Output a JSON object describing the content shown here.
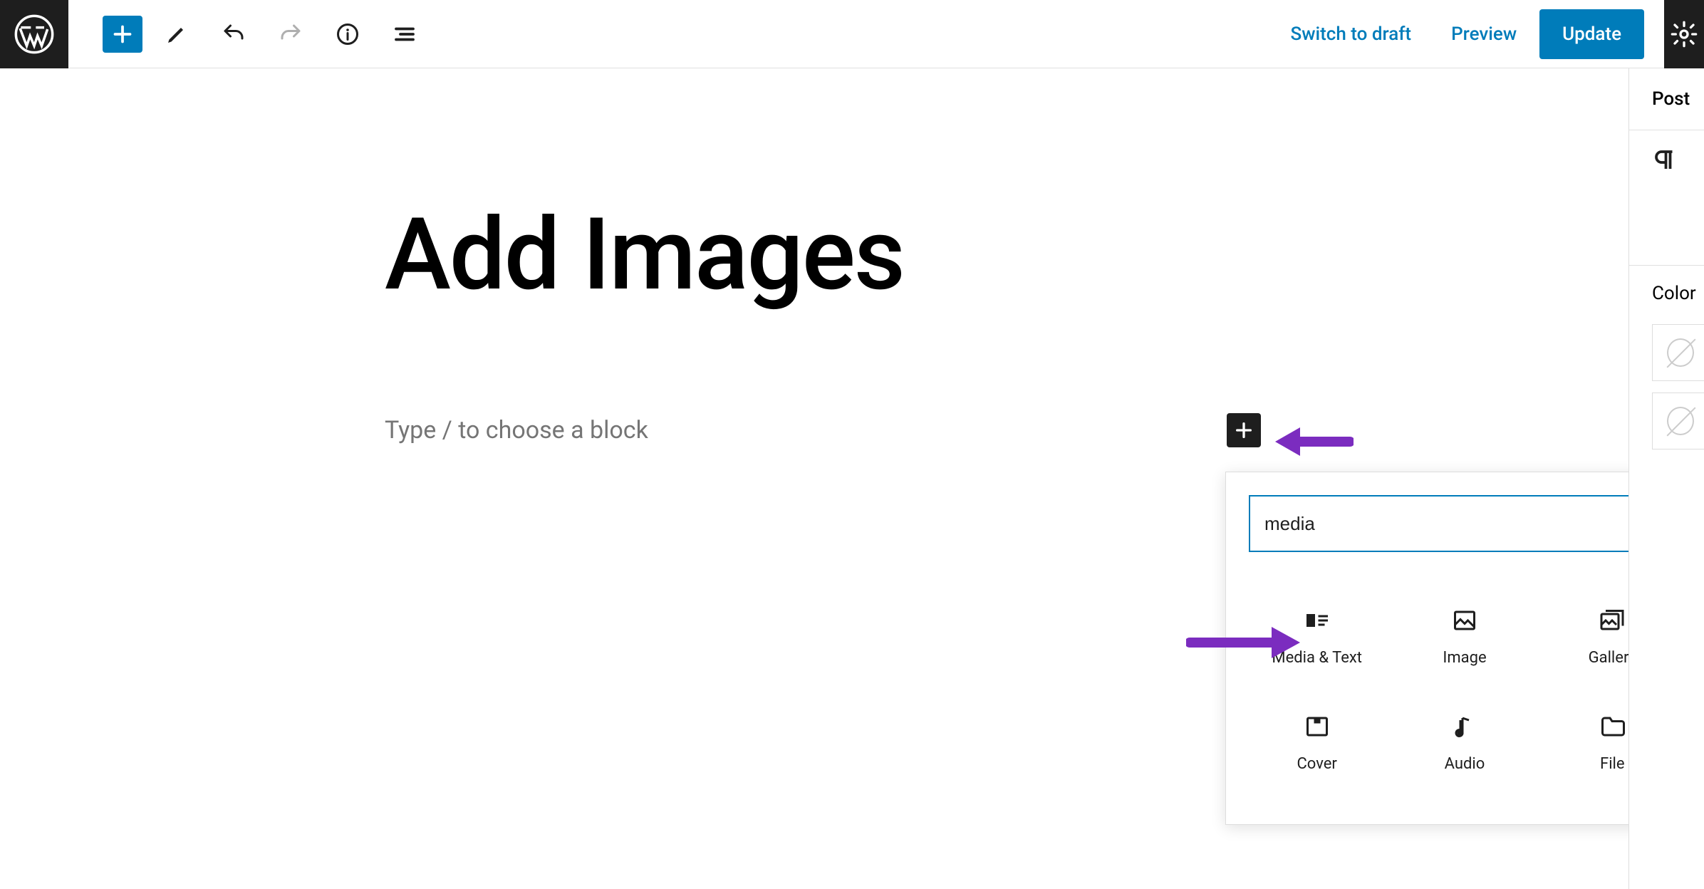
{
  "toolbar": {
    "switch_draft": "Switch to draft",
    "preview": "Preview",
    "update": "Update"
  },
  "editor": {
    "title": "Add Images",
    "placeholder": "Type / to choose a block"
  },
  "inserter": {
    "search_value": "media",
    "blocks": [
      {
        "label": "Media & Text",
        "icon": "media-text-icon"
      },
      {
        "label": "Image",
        "icon": "image-icon"
      },
      {
        "label": "Gallery",
        "icon": "gallery-icon"
      },
      {
        "label": "Cover",
        "icon": "cover-icon"
      },
      {
        "label": "Audio",
        "icon": "audio-icon"
      },
      {
        "label": "File",
        "icon": "file-icon"
      }
    ]
  },
  "sidebar": {
    "tab": "Post",
    "color_label": "Color"
  }
}
